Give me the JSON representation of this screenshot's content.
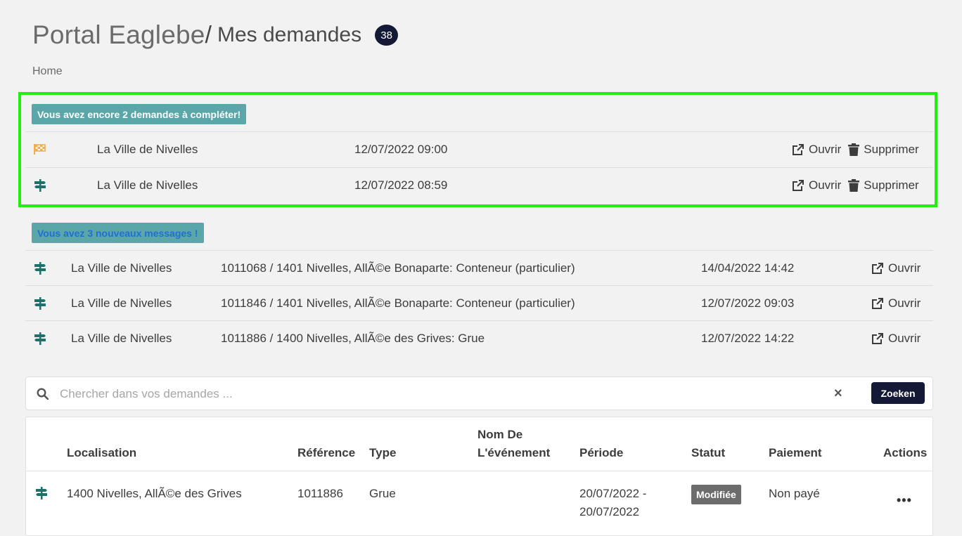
{
  "header": {
    "portal": "Portal Eaglebe",
    "separator": "/",
    "title": "Mes demandes",
    "count": "38"
  },
  "breadcrumb": {
    "home": "Home"
  },
  "incomplete": {
    "badge": "Vous avez encore 2 demandes à compléter!",
    "rows": [
      {
        "icon": "checkered-flag-icon",
        "org": "La Ville de Nivelles",
        "date": "12/07/2022 09:00",
        "open": "Ouvrir",
        "delete": "Supprimer"
      },
      {
        "icon": "signpost-icon",
        "org": "La Ville de Nivelles",
        "date": "12/07/2022 08:59",
        "open": "Ouvrir",
        "delete": "Supprimer"
      }
    ]
  },
  "messages": {
    "badge": "Vous avez 3 nouveaux messages !",
    "rows": [
      {
        "icon": "signpost-icon",
        "org": "La Ville de Nivelles",
        "subject": "1011068 / 1401 Nivelles, AllÃ©e Bonaparte: Conteneur (particulier)",
        "date": "14/04/2022 14:42",
        "open": "Ouvrir"
      },
      {
        "icon": "signpost-icon",
        "org": "La Ville de Nivelles",
        "subject": "1011846 / 1401 Nivelles, AllÃ©e Bonaparte: Conteneur (particulier)",
        "date": "12/07/2022 09:03",
        "open": "Ouvrir"
      },
      {
        "icon": "signpost-icon",
        "org": "La Ville de Nivelles",
        "subject": "1011886 / 1400 Nivelles, AllÃ©e des Grives: Grue",
        "date": "12/07/2022 14:22",
        "open": "Ouvrir"
      }
    ]
  },
  "search": {
    "placeholder": "Chercher dans vos demandes ...",
    "value": "",
    "clear": "×",
    "button": "Zoeken"
  },
  "table": {
    "columns": {
      "localisation": "Localisation",
      "reference": "Référence",
      "type": "Type",
      "event_line1": "Nom De",
      "event_line2": "L'événement",
      "period": "Période",
      "status": "Statut",
      "payment": "Paiement",
      "actions": "Actions"
    },
    "rows": [
      {
        "icon": "signpost-icon",
        "localisation": "1400 Nivelles, AllÃ©e des Grives",
        "reference": "1011886",
        "type": "Grue",
        "event": "",
        "period_line1": "20/07/2022 -",
        "period_line2": "20/07/2022",
        "status": "Modifiée",
        "payment": "Non payé",
        "actions": "•••"
      }
    ]
  },
  "colors": {
    "accent_dark": "#141a36",
    "badge_teal": "#5aa6a8",
    "flag_orange": "#f0ad4e",
    "signpost_teal": "#1f6f6a",
    "highlight_green": "#22ee11"
  }
}
